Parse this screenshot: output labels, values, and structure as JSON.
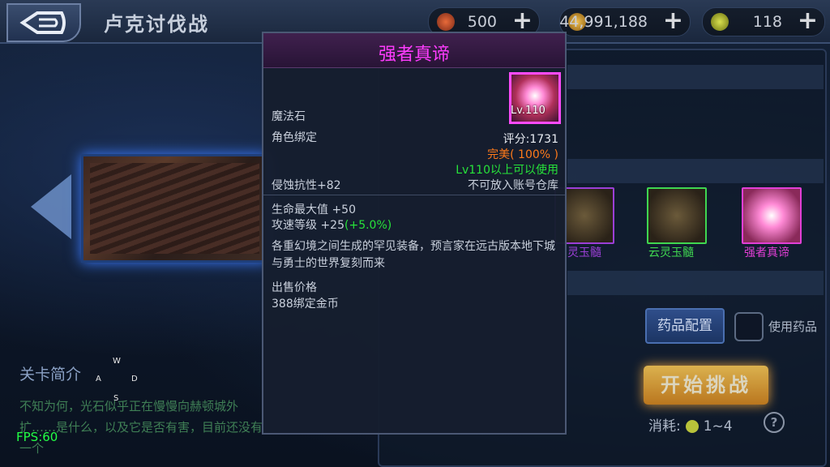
{
  "topbar": {
    "title": "卢克讨伐战",
    "resources": [
      {
        "icon": "fatigue-potion-icon",
        "value": "500",
        "plus": "+"
      },
      {
        "icon": "gold-coin-icon",
        "value": "44,991,188",
        "plus": "+"
      },
      {
        "icon": "ticket-icon",
        "value": "118",
        "plus": "+"
      }
    ]
  },
  "left": {
    "intro_title": "关卡简介",
    "intro_text": "不知为何，光石似乎正在慢慢向赫顿城外扩……是什么，以及它是否有害，目前还没有一个",
    "fps": "FPS:60",
    "joystick": {
      "w": "W",
      "a": "A",
      "s": "S",
      "d": "D"
    }
  },
  "right": {
    "rewards": [
      {
        "label": "灵玉髓",
        "color": "#9b3fd6"
      },
      {
        "label": "云灵玉髓",
        "color": "#3fd650"
      },
      {
        "label": "强者真谛",
        "color": "#e23fd6"
      }
    ],
    "medicine_button": "药品配置",
    "use_medicine": "使用药品",
    "start_button": "开始挑战",
    "cost_label": "消耗:",
    "cost_value": "1~4",
    "help": "?"
  },
  "tooltip": {
    "title": "强者真谛",
    "item_level": "Lv.110",
    "type": "魔法石",
    "bind": "角色绑定",
    "score": "评分:1731",
    "quality": "完美( 100% )",
    "req": "Lv110以上可以使用",
    "resist": "侵蚀抗性+82",
    "storage": "不可放入账号仓库",
    "stat1": "生命最大值 +50",
    "stat2_prefix": "攻速等级 +25",
    "stat2_bonus": "(+5.0%)",
    "desc": "各重幻境之间生成的罕见装备，预言家在远古版本地下城与勇士的世界复刻而来",
    "sell_label": "出售价格",
    "sell_value": "388绑定金币"
  }
}
